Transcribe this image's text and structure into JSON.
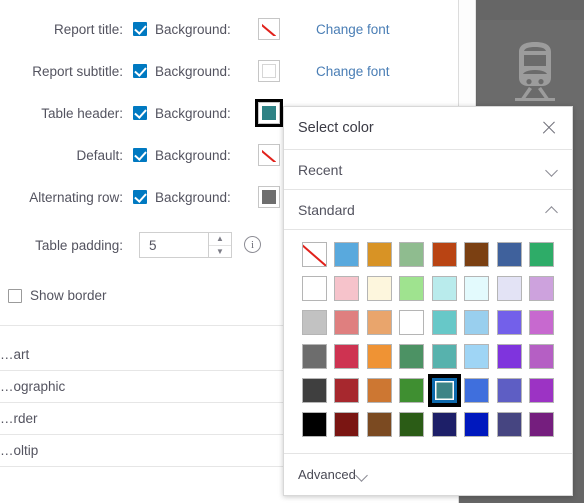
{
  "thumbnail": {
    "icon": "train-icon"
  },
  "settings": {
    "rows": [
      {
        "label": "Report title:",
        "checkbox_label": "Background:",
        "checked": true,
        "swatch": "none",
        "swatch_color": "",
        "font_link": "Change font",
        "focused": false
      },
      {
        "label": "Report subtitle:",
        "checkbox_label": "Background:",
        "checked": true,
        "swatch": "color",
        "swatch_color": "#ffffff",
        "font_link": "Change font",
        "focused": false
      },
      {
        "label": "Table header:",
        "checkbox_label": "Background:",
        "checked": true,
        "swatch": "color",
        "swatch_color": "#2e8285",
        "font_link": "",
        "focused": true
      },
      {
        "label": "Default:",
        "checkbox_label": "Background:",
        "checked": true,
        "swatch": "none",
        "swatch_color": "",
        "font_link": "",
        "focused": false
      },
      {
        "label": "Alternating row:",
        "checkbox_label": "Background:",
        "checked": true,
        "swatch": "color",
        "swatch_color": "#6e6e6e",
        "font_link": "",
        "focused": false
      }
    ],
    "padding": {
      "label": "Table padding:",
      "value": "5",
      "increment_icon": "chevron-up-icon",
      "decrement_icon": "chevron-down-icon",
      "info_icon": "info-icon",
      "info_glyph": "i"
    },
    "show_border": {
      "label": "Show border",
      "checked": false
    }
  },
  "list": {
    "items": [
      {
        "label": "…art"
      },
      {
        "label": "…ographic"
      },
      {
        "label": "…rder"
      },
      {
        "label": "…oltip"
      }
    ]
  },
  "color_picker": {
    "title": "Select color",
    "close_icon": "close-icon",
    "sections": {
      "recent": {
        "label": "Recent",
        "expanded": false,
        "chevron": "chevron-down-icon"
      },
      "standard": {
        "label": "Standard",
        "expanded": true,
        "chevron": "chevron-up-icon"
      },
      "advanced": {
        "label": "Advanced",
        "expanded": false,
        "chevron": "chevron-down-icon"
      }
    },
    "selected_color": "#3d8486",
    "selection_border": "#0d69ad",
    "swatches": [
      {
        "color": "",
        "no_color": true
      },
      {
        "color": "#59a9dd",
        "no_color": false
      },
      {
        "color": "#d89325",
        "no_color": false
      },
      {
        "color": "#8fbc8f",
        "no_color": false
      },
      {
        "color": "#b94413",
        "no_color": false
      },
      {
        "color": "#7b4012",
        "no_color": false
      },
      {
        "color": "#3f619c",
        "no_color": false
      },
      {
        "color": "#2eac68",
        "no_color": false
      },
      {
        "color": "#ffffff",
        "no_color": false
      },
      {
        "color": "#f6c3cb",
        "no_color": false
      },
      {
        "color": "#fdf6dd",
        "no_color": false
      },
      {
        "color": "#9fe38f",
        "no_color": false
      },
      {
        "color": "#b9ebec",
        "no_color": false
      },
      {
        "color": "#e3fafd",
        "no_color": false
      },
      {
        "color": "#e3e3f5",
        "no_color": false
      },
      {
        "color": "#cda2dd",
        "no_color": false
      },
      {
        "color": "#c2c2c2",
        "no_color": false
      },
      {
        "color": "#df7f7f",
        "no_color": false
      },
      {
        "color": "#e9a56c",
        "no_color": false
      },
      {
        "color": "#60c martin",
        "no_color": false
      },
      {
        "color": "#67c8c8",
        "no_color": false
      },
      {
        "color": "#99cfee",
        "no_color": false
      },
      {
        "color": "#7360ea",
        "no_color": false
      },
      {
        "color": "#c769cf",
        "no_color": false
      },
      {
        "color": "#6d6d6d",
        "no_color": false
      },
      {
        "color": "#ce3351",
        "no_color": false
      },
      {
        "color": "#ef9334",
        "no_color": false
      },
      {
        "color": "#4c9264",
        "no_color": false
      },
      {
        "color": "#57b2ad",
        "no_color": false
      },
      {
        "color": "#9fd5f5",
        "no_color": false
      },
      {
        "color": "#7f34dd",
        "no_color": false
      },
      {
        "color": "#b55fc4",
        "no_color": false
      },
      {
        "color": "#3f3f3f",
        "no_color": false
      },
      {
        "color": "#a7282e",
        "no_color": false
      },
      {
        "color": "#cd7732",
        "no_color": false
      },
      {
        "color": "#3f8f31",
        "no_color": false
      },
      {
        "color": "#3d8486",
        "no_color": false
      },
      {
        "color": "#3f6fdd",
        "no_color": false
      },
      {
        "color": "#5e5ec4",
        "no_color": false
      },
      {
        "color": "#9c33c4",
        "no_color": false
      },
      {
        "color": "#000000",
        "no_color": false
      },
      {
        "color": "#7a1512",
        "no_color": false
      },
      {
        "color": "#7b4a21",
        "no_color": false
      },
      {
        "color": "#2b5c16",
        "no_color": false
      },
      {
        "color": "#1d1f68",
        "no_color": false
      },
      {
        "color": "#0018be",
        "no_color": false
      },
      {
        "color": "#464581",
        "no_color": false
      },
      {
        "color": "#751e7e",
        "no_color": false
      }
    ],
    "selected_index": 36
  }
}
